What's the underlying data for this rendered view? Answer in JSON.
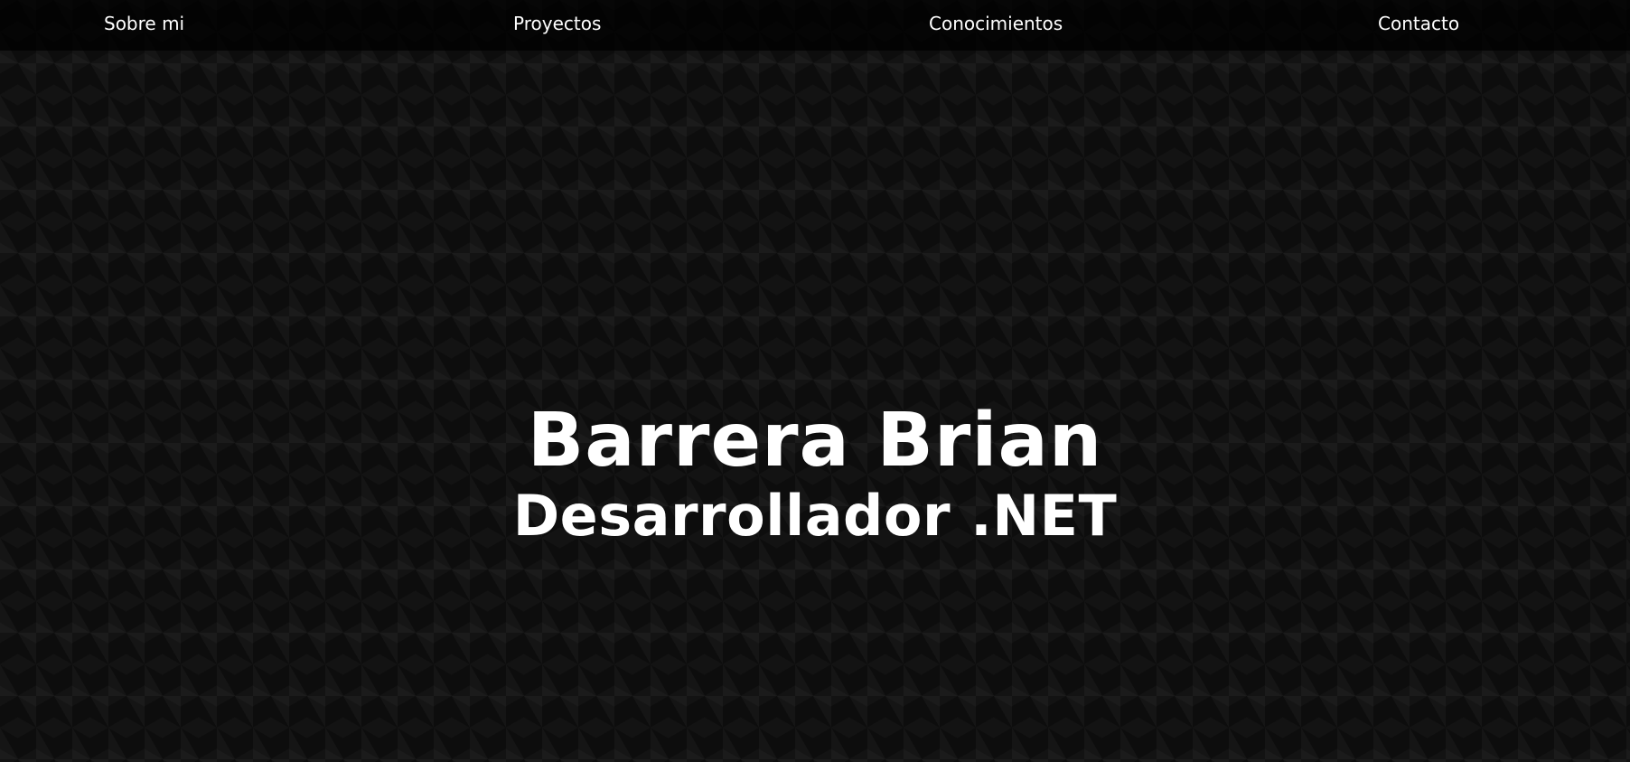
{
  "nav": {
    "items": [
      {
        "label": "Sobre mi"
      },
      {
        "label": "Proyectos"
      },
      {
        "label": "Conocimientos"
      },
      {
        "label": "Contacto"
      }
    ]
  },
  "hero": {
    "name": "Barrera Brian",
    "role": "Desarrollador .NET"
  },
  "colors": {
    "background": "#0d0d0d",
    "text": "#ffffff",
    "navbar": "#000000"
  }
}
